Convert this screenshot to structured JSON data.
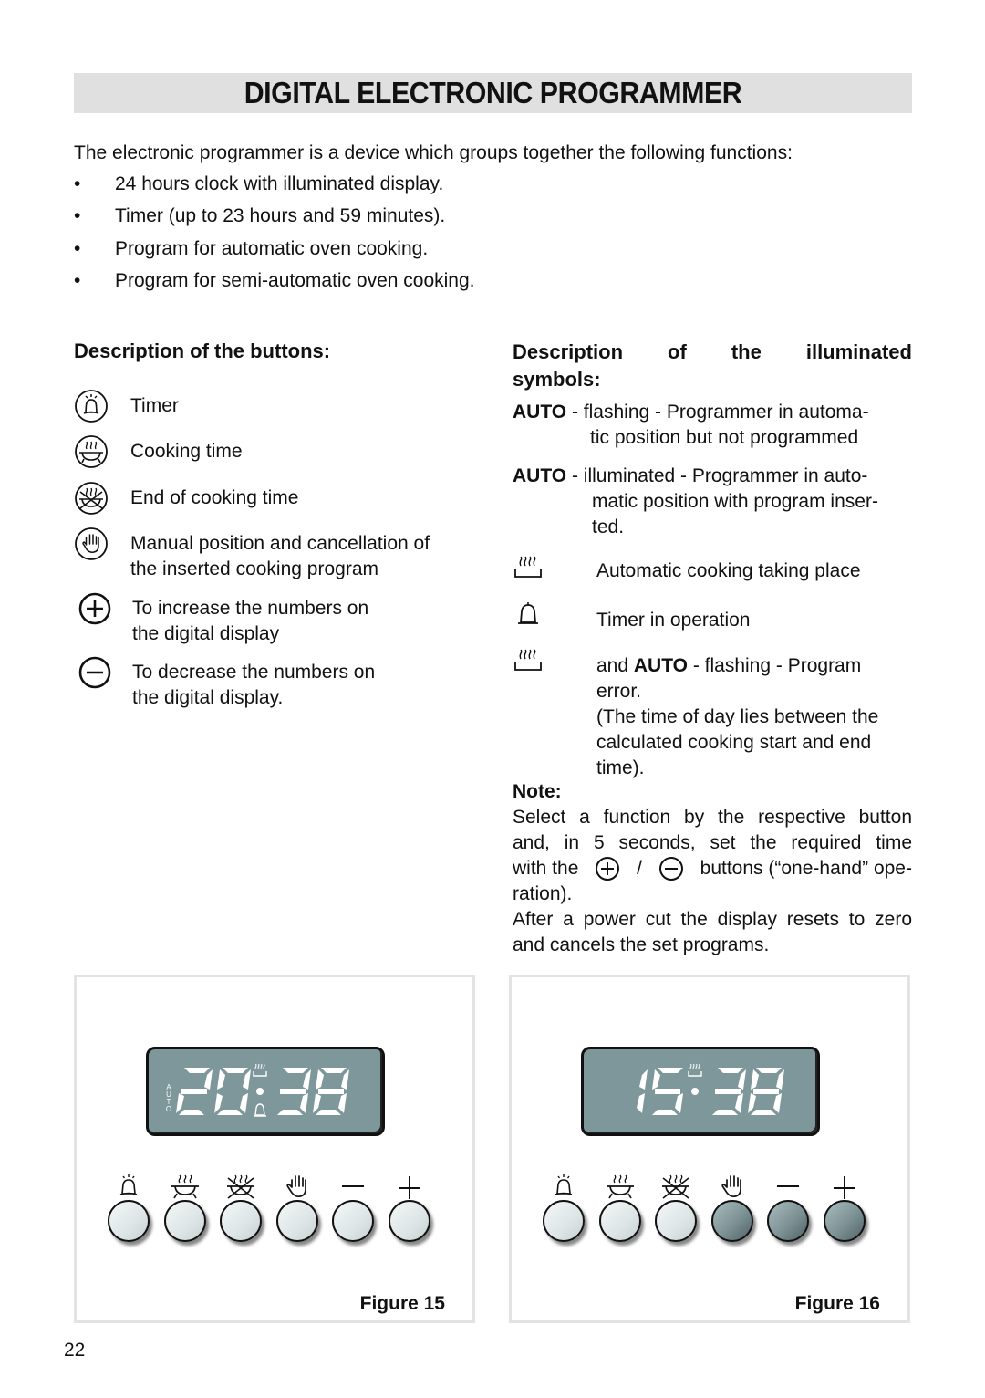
{
  "page": {
    "title": "DIGITAL ELECTRONIC PROGRAMMER",
    "intro": "The electronic programmer is a device which groups together the following functions:",
    "bullets": [
      "24 hours clock with illuminated display.",
      "Timer (up to 23 hours and 59 minutes).",
      "Program for automatic oven cooking.",
      "Program for semi-automatic oven cooking."
    ],
    "page_number": "22"
  },
  "buttons_section": {
    "heading": "Description of the buttons:",
    "items": [
      {
        "icon": "timer-bell-icon",
        "lines": [
          "Timer"
        ]
      },
      {
        "icon": "cooking-time-pot-icon",
        "lines": [
          "Cooking time"
        ]
      },
      {
        "icon": "end-of-cooking-icon",
        "lines": [
          "End of cooking time"
        ]
      },
      {
        "icon": "manual-hand-icon",
        "lines": [
          "Manual position and cancellation of",
          "the inserted cooking program"
        ]
      },
      {
        "icon": "plus-circle-icon",
        "lines": [
          "To increase the numbers on",
          "the digital display"
        ]
      },
      {
        "icon": "minus-circle-icon",
        "lines": [
          "To decrease the numbers on",
          "the digital display."
        ]
      }
    ]
  },
  "symbols_section": {
    "heading_line1": [
      "Description",
      "of",
      "the",
      "illuminated"
    ],
    "heading_line2": "symbols:",
    "auto_items": [
      {
        "label": "AUTO",
        "sep": " - ",
        "line1": "flashing - Programmer in automa-",
        "rest": [
          "tic position but not programmed"
        ]
      },
      {
        "label": "AUTO",
        "sep": " - ",
        "line1": "illuminated - Programmer in auto-",
        "rest": [
          "matic position with program inser-",
          "ted."
        ]
      }
    ],
    "symbol_items": [
      {
        "icon": "automatic-cooking-icon",
        "lines": [
          "Automatic cooking taking place"
        ]
      },
      {
        "icon": "timer-operation-bell-icon",
        "lines": [
          "Timer in operation"
        ]
      },
      {
        "icon": "automatic-cooking-icon",
        "prefix": "and ",
        "bold": "AUTO",
        "suffix": " - flashing - Program",
        "lines": [
          "error.",
          "(The time of day lies between the",
          "calculated cooking start and end",
          "time)."
        ]
      }
    ],
    "note": {
      "heading": "Note:",
      "p1_lines": [
        "Select a function by the respective button",
        "and, in 5 seconds, set the required time"
      ],
      "p1_line3_a": "with the",
      "p1_line3_sep": "/",
      "p1_line3_b": "buttons (“one-hand” ope-",
      "p1_line4": "ration).",
      "p2_lines": [
        "After a power cut the display resets to zero",
        "and cancels the set programs."
      ]
    }
  },
  "figures": [
    {
      "caption": "Figure 15",
      "display_time": "20:38",
      "auto_indicator": "AUTO",
      "show_auto": true,
      "show_cooking_symbol": true,
      "show_bell_symbol": true,
      "keys": [
        {
          "name": "timer",
          "state": "light"
        },
        {
          "name": "cooking-time",
          "state": "light"
        },
        {
          "name": "end-of-cooking",
          "state": "light"
        },
        {
          "name": "manual",
          "state": "light"
        },
        {
          "name": "minus",
          "state": "light"
        },
        {
          "name": "plus",
          "state": "light"
        }
      ]
    },
    {
      "caption": "Figure 16",
      "display_time": "15:38",
      "auto_indicator": "",
      "show_auto": false,
      "show_cooking_symbol": true,
      "show_bell_symbol": false,
      "keys": [
        {
          "name": "timer",
          "state": "light"
        },
        {
          "name": "cooking-time",
          "state": "light"
        },
        {
          "name": "end-of-cooking",
          "state": "light"
        },
        {
          "name": "manual",
          "state": "dark"
        },
        {
          "name": "minus",
          "state": "dark"
        },
        {
          "name": "plus",
          "state": "dark"
        }
      ]
    }
  ],
  "colors": {
    "title_bar": "#e0e0e0",
    "lcd_background": "#7e979a",
    "lcd_segment": "#ffffff",
    "key_light": "#e4eaeb",
    "key_dark": "#7d9295",
    "figure_border": "#e3e3e3"
  }
}
